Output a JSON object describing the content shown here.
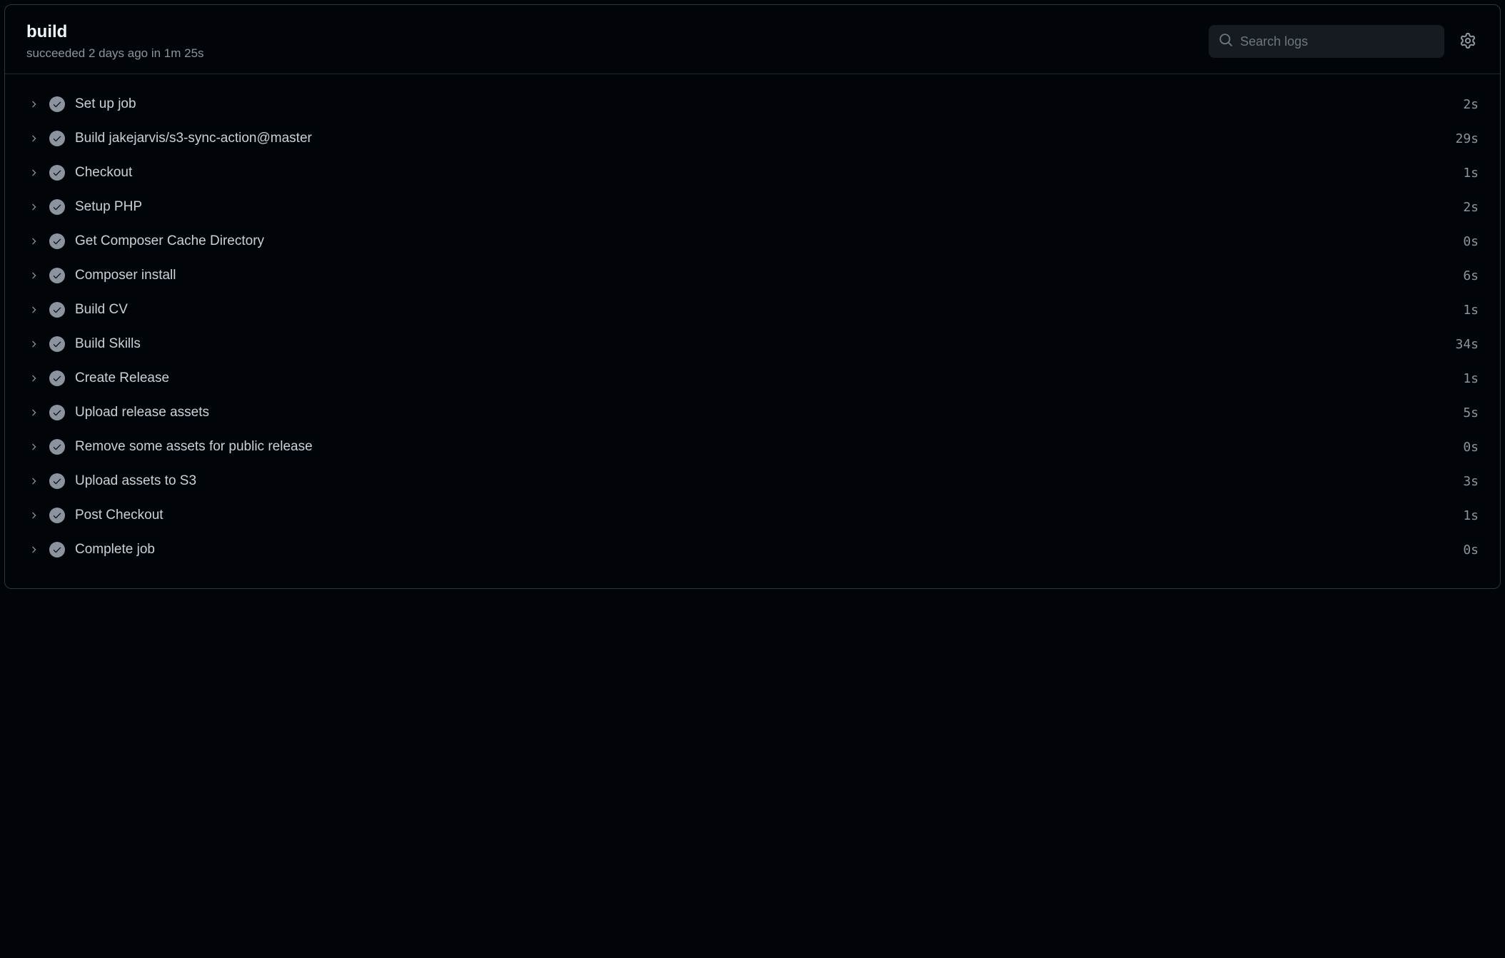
{
  "header": {
    "title": "build",
    "subtitle": "succeeded 2 days ago in 1m 25s"
  },
  "search": {
    "placeholder": "Search logs"
  },
  "steps": [
    {
      "name": "Set up job",
      "duration": "2s"
    },
    {
      "name": "Build jakejarvis/s3-sync-action@master",
      "duration": "29s"
    },
    {
      "name": "Checkout",
      "duration": "1s"
    },
    {
      "name": "Setup PHP",
      "duration": "2s"
    },
    {
      "name": "Get Composer Cache Directory",
      "duration": "0s"
    },
    {
      "name": "Composer install",
      "duration": "6s"
    },
    {
      "name": "Build CV",
      "duration": "1s"
    },
    {
      "name": "Build Skills",
      "duration": "34s"
    },
    {
      "name": "Create Release",
      "duration": "1s"
    },
    {
      "name": "Upload release assets",
      "duration": "5s"
    },
    {
      "name": "Remove some assets for public release",
      "duration": "0s"
    },
    {
      "name": "Upload assets to S3",
      "duration": "3s"
    },
    {
      "name": "Post Checkout",
      "duration": "1s"
    },
    {
      "name": "Complete job",
      "duration": "0s"
    }
  ]
}
